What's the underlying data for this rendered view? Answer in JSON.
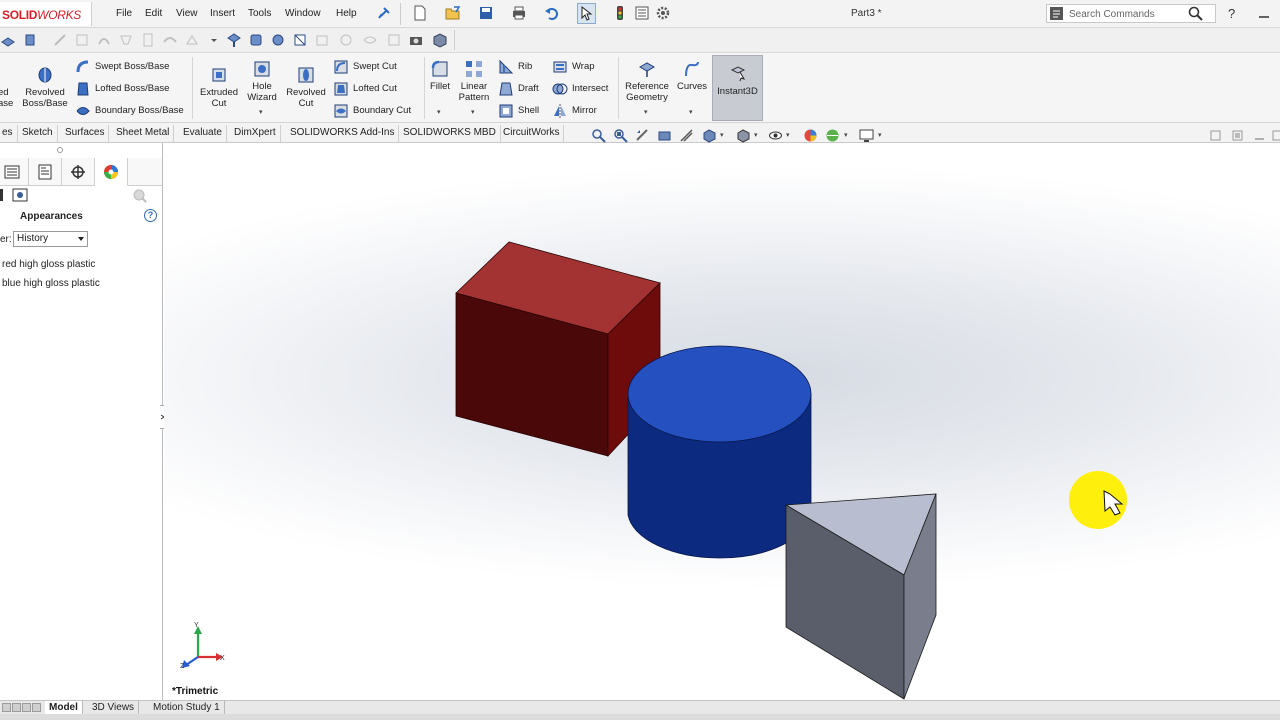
{
  "app": {
    "logo_bold": "SOLID",
    "logo_rest": "WORKS",
    "doc_title": "Part3 *"
  },
  "menu": [
    "File",
    "Edit",
    "View",
    "Insert",
    "Tools",
    "Window",
    "Help"
  ],
  "search": {
    "placeholder": "Search Commands"
  },
  "ribbon": {
    "revolved_boss": "Revolved Boss/Base",
    "lofted_left_cut": "ed ase",
    "swept_boss": "Swept Boss/Base",
    "lofted_boss": "Lofted Boss/Base",
    "boundary_boss": "Boundary Boss/Base",
    "extruded_cut": "Extruded Cut",
    "hole_wizard": "Hole Wizard",
    "revolved_cut": "Revolved Cut",
    "swept_cut": "Swept Cut",
    "lofted_cut": "Lofted Cut",
    "boundary_cut": "Boundary Cut",
    "fillet": "Fillet",
    "linear_pattern": "Linear Pattern",
    "rib": "Rib",
    "draft": "Draft",
    "shell": "Shell",
    "wrap": "Wrap",
    "intersect": "Intersect",
    "mirror": "Mirror",
    "reference_geometry": "Reference Geometry",
    "curves": "Curves",
    "instant3d": "Instant3D"
  },
  "cm_tabs": [
    "es",
    "Sketch",
    "Surfaces",
    "Sheet Metal",
    "Evaluate",
    "DimXpert",
    "SOLIDWORKS Add-Ins",
    "SOLIDWORKS MBD",
    "CircuitWorks"
  ],
  "panel": {
    "title": "Appearances",
    "help": "?",
    "filter_label": "er:",
    "filter_value": "History",
    "history": [
      "red high gloss plastic",
      "blue high gloss plastic"
    ]
  },
  "viewport": {
    "view_name": "*Trimetric",
    "axes": {
      "x": "X",
      "y": "Y",
      "z": "Z"
    }
  },
  "bottom_tabs": [
    "Model",
    "3D Views",
    "Motion Study 1"
  ],
  "colors": {
    "box_front": "#4a0808",
    "box_top": "#a03434",
    "cylinder_top": "#2550c0",
    "cylinder_side": "#0c2a80",
    "prism_top": "#b8bed0",
    "prism_side": "#5a5e6a",
    "cursor_highlight": "#ffee00"
  }
}
